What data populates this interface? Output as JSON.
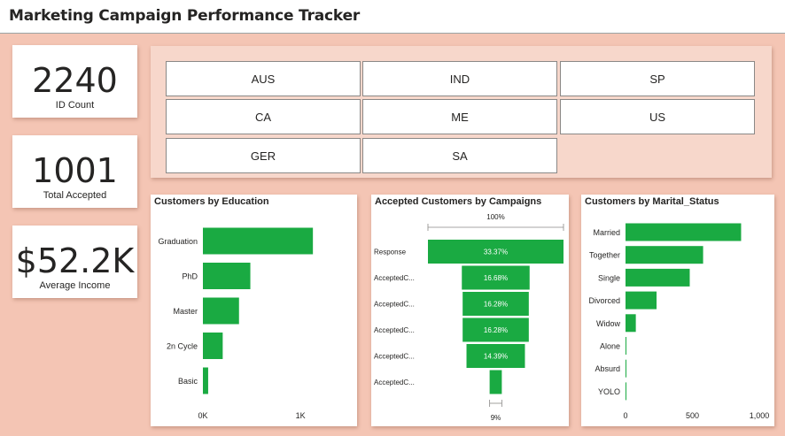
{
  "header": {
    "title": "Marketing Campaign Performance Tracker"
  },
  "kpis": [
    {
      "value": "2240",
      "label": "ID Count"
    },
    {
      "value": "1001",
      "label": "Total Accepted"
    },
    {
      "value": "$52.2K",
      "label": "Average Income"
    }
  ],
  "slicer": {
    "countries": [
      "AUS",
      "IND",
      "SP",
      "CA",
      "ME",
      "US",
      "GER",
      "SA"
    ]
  },
  "colors": {
    "bar": "#1aaa42",
    "background": "#f4c5b4",
    "panel": "#f7d7cb"
  },
  "chart_data": [
    {
      "type": "bar",
      "orientation": "horizontal",
      "title": "Customers by Education",
      "categories": [
        "Graduation",
        "PhD",
        "Master",
        "2n Cycle",
        "Basic"
      ],
      "values": [
        1127,
        486,
        370,
        203,
        54
      ],
      "xlim": [
        0,
        1180
      ],
      "xticks": [
        {
          "value": 0,
          "label": "0K"
        },
        {
          "value": 1000,
          "label": "1K"
        }
      ]
    },
    {
      "type": "bar",
      "orientation": "funnel",
      "title": "Accepted Customers by Campaigns",
      "categories": [
        "Response",
        "AcceptedC...",
        "AcceptedC...",
        "AcceptedC...",
        "AcceptedC...",
        "AcceptedC..."
      ],
      "values": [
        334,
        167,
        163,
        163,
        144,
        30
      ],
      "data_labels": [
        "33.37%",
        "16.68%",
        "16.28%",
        "16.28%",
        "14.39%",
        ""
      ],
      "top_label": "100%",
      "bottom_label": "9%"
    },
    {
      "type": "bar",
      "orientation": "horizontal",
      "title": "Customers by Marital_Status",
      "categories": [
        "Married",
        "Together",
        "Single",
        "Divorced",
        "Widow",
        "Alone",
        "Absurd",
        "YOLO"
      ],
      "values": [
        864,
        580,
        480,
        232,
        77,
        3,
        2,
        2
      ],
      "xlim": [
        0,
        1000
      ],
      "xticks": [
        {
          "value": 0,
          "label": "0"
        },
        {
          "value": 500,
          "label": "500"
        },
        {
          "value": 1000,
          "label": "1,000"
        }
      ]
    }
  ]
}
